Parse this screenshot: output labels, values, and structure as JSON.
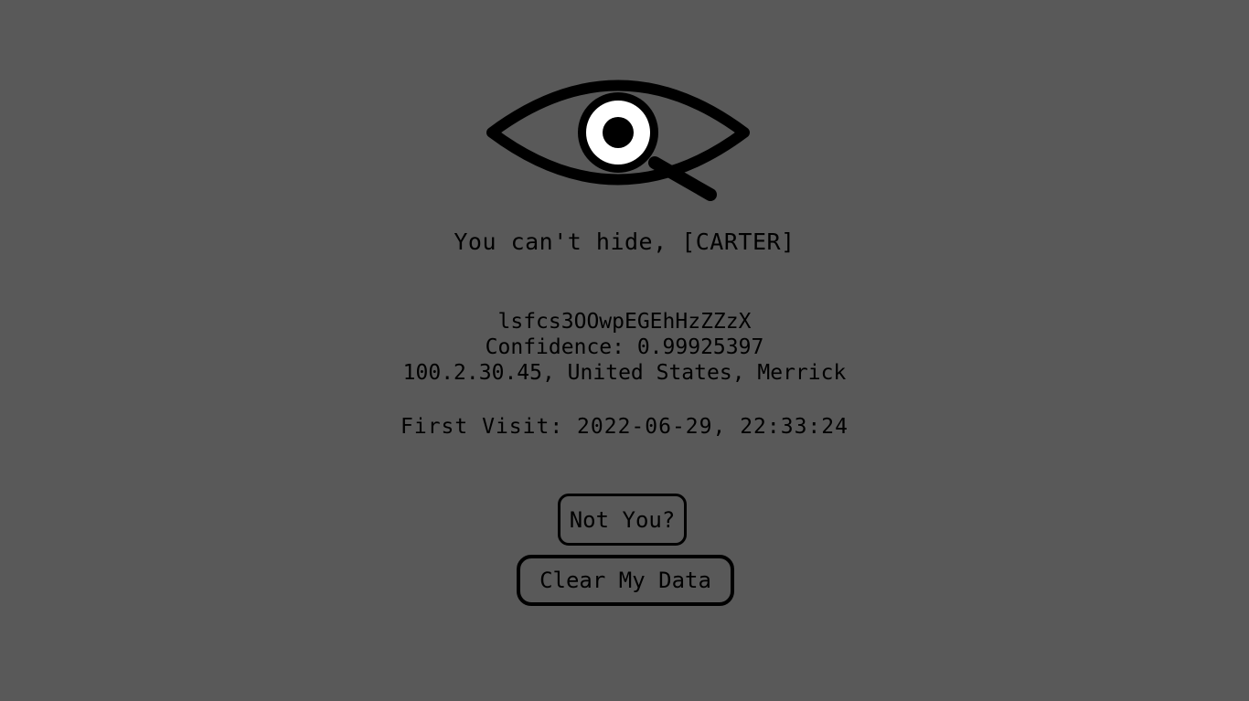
{
  "logo": {
    "icon": "eye-magnifier-icon"
  },
  "greeting": "You can't hide, [CARTER]",
  "visitor": {
    "id": "lsfcs3OOwpEGEhHzZZzX",
    "confidence": "Confidence: 0.99925397",
    "location": "100.2.30.45, United States, Merrick",
    "first_visit": "First Visit: 2022-06-29, 22:33:24"
  },
  "buttons": {
    "not_you": "Not You?",
    "clear_data": "Clear My Data"
  },
  "colors": {
    "background": "#595959",
    "foreground": "#000000",
    "iris": "#ffffff"
  }
}
